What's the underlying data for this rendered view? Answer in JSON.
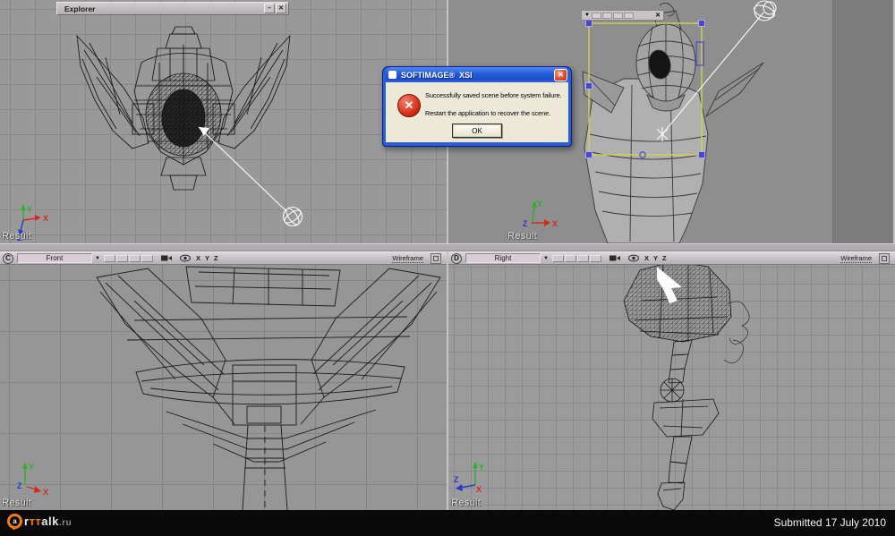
{
  "explorer_window": {
    "title": "Explorer"
  },
  "dialog": {
    "title": "SOFTIMAGE®  XSI",
    "line1": "Successfully saved scene before system failure.",
    "line2": "Restart the application to recover the scene.",
    "ok": "OK"
  },
  "icons": {
    "dropdown": "▼",
    "close": "✕",
    "minimize": "–"
  },
  "viewports": {
    "top_left": {
      "result": "Result"
    },
    "top_right": {
      "result": "Result"
    },
    "bottom_left": {
      "letter": "C",
      "view": "Front",
      "mode": "Wireframe",
      "result": "Result"
    },
    "bottom_right": {
      "letter": "D",
      "view": "Right",
      "mode": "Wireframe",
      "result": "Result"
    }
  },
  "axis": {
    "x": "X",
    "y": "Y",
    "z": "Z"
  },
  "footer": {
    "logo_a": "a",
    "logo_r": "r",
    "logo_tt": "тт",
    "logo_alk": "alk",
    "logo_ru": ".ru",
    "submitted": "Submitted 17 July 2010"
  },
  "colors": {
    "axis_x": "#d42a1e",
    "axis_y": "#2fae2f",
    "axis_z": "#2b39c8",
    "selection_yellow": "#d8d04e",
    "handle_blue": "#4646d0",
    "xp_titlebar_blue": "#245ad8",
    "dialog_body": "#ece9d8",
    "error_red": "#dc3620",
    "logo_orange": "#f07b17"
  }
}
